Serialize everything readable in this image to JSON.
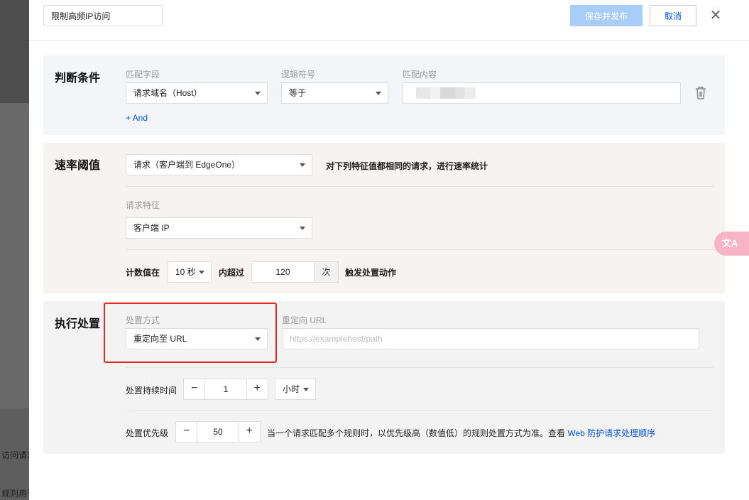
{
  "background_page": {
    "text1": "访问请求",
    "text2": "规则用于"
  },
  "header": {
    "rule_name_value": "限制高频IP访问",
    "save_label": "保存并发布",
    "cancel_label": "取消",
    "close_icon": "close-icon"
  },
  "condition": {
    "title": "判断条件",
    "field_label": "匹配字段",
    "field_value": "请求域名（Host）",
    "operator_label": "逻辑符号",
    "operator_value": "等于",
    "content_label": "匹配内容",
    "and_label": "+ And"
  },
  "rate": {
    "title": "速率阈值",
    "scope_value": "请求（客户端到 EdgeOne）",
    "scope_hint": "对下列特征值都相同的请求，进行速率统计",
    "feature_label": "请求特征",
    "feature_value": "客户端 IP",
    "count_prefix": "计数值在",
    "window_value": "10 秒",
    "within_label": "内超过",
    "count_value": "120",
    "count_unit": "次",
    "trigger_label": "触发处置动作"
  },
  "action": {
    "title": "执行处置",
    "method_label": "处置方式",
    "method_value": "重定向至 URL",
    "redirect_label": "重定向 URL",
    "redirect_placeholder": "https://examplehost/path",
    "duration_label": "处置持续时间",
    "duration_value": "1",
    "duration_unit": "小时",
    "priority_label": "处置优先级",
    "priority_value": "50",
    "priority_hint": "当一个请求匹配多个规则时，以优先级高（数值低）的规则处置方式为准。查看",
    "priority_link": "Web 防护请求处理顺序"
  },
  "floating": {
    "translate_label": "文A"
  },
  "colors": {
    "primary": "#0052d9",
    "save_disabled": "#a8cdf9",
    "highlight": "#e5251e"
  }
}
